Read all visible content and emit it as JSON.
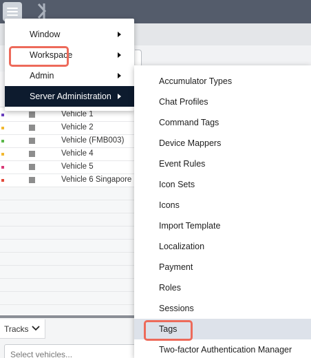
{
  "colors": {
    "topbar": "#545c6b",
    "active_menu_bg": "#0d1b2e",
    "highlight_box": "#ed6a5a",
    "submenu_hover": "#dde2ea"
  },
  "topbar": {
    "menu_icon": "hamburger-icon",
    "logo_icon": "app-logo-icon"
  },
  "main_menu": {
    "items": [
      {
        "label": "Window",
        "has_submenu": true
      },
      {
        "label": "Workspace",
        "has_submenu": true
      },
      {
        "label": "Admin",
        "has_submenu": true,
        "highlighted": true
      },
      {
        "label": "Server Administration",
        "has_submenu": true,
        "active": true
      }
    ]
  },
  "sub_menu": {
    "items": [
      {
        "label": "Accumulator Types"
      },
      {
        "label": "Chat Profiles"
      },
      {
        "label": "Command Tags"
      },
      {
        "label": "Device Mappers"
      },
      {
        "label": "Event Rules"
      },
      {
        "label": "Icon Sets"
      },
      {
        "label": "Icons"
      },
      {
        "label": "Import Template"
      },
      {
        "label": "Localization"
      },
      {
        "label": "Payment"
      },
      {
        "label": "Roles"
      },
      {
        "label": "Sessions"
      },
      {
        "label": "Tags",
        "highlighted": true
      },
      {
        "label": "Two-factor Authentication Manager"
      }
    ]
  },
  "vehicles": [
    {
      "name": "Vehicle 1",
      "color": "#6a3fbf"
    },
    {
      "name": "Vehicle 2",
      "color": "#f2b830"
    },
    {
      "name": "Vehicle (FMB003)",
      "color": "#5bb84a"
    },
    {
      "name": "Vehicle 4",
      "color": "#f2b830"
    },
    {
      "name": "Vehicle 5",
      "color": "#d93a78"
    },
    {
      "name": "Vehicle 6 Singapore",
      "color": "#e24b3b"
    }
  ],
  "tracks": {
    "tab_label": "Tracks",
    "select_placeholder": "Select vehicles..."
  }
}
